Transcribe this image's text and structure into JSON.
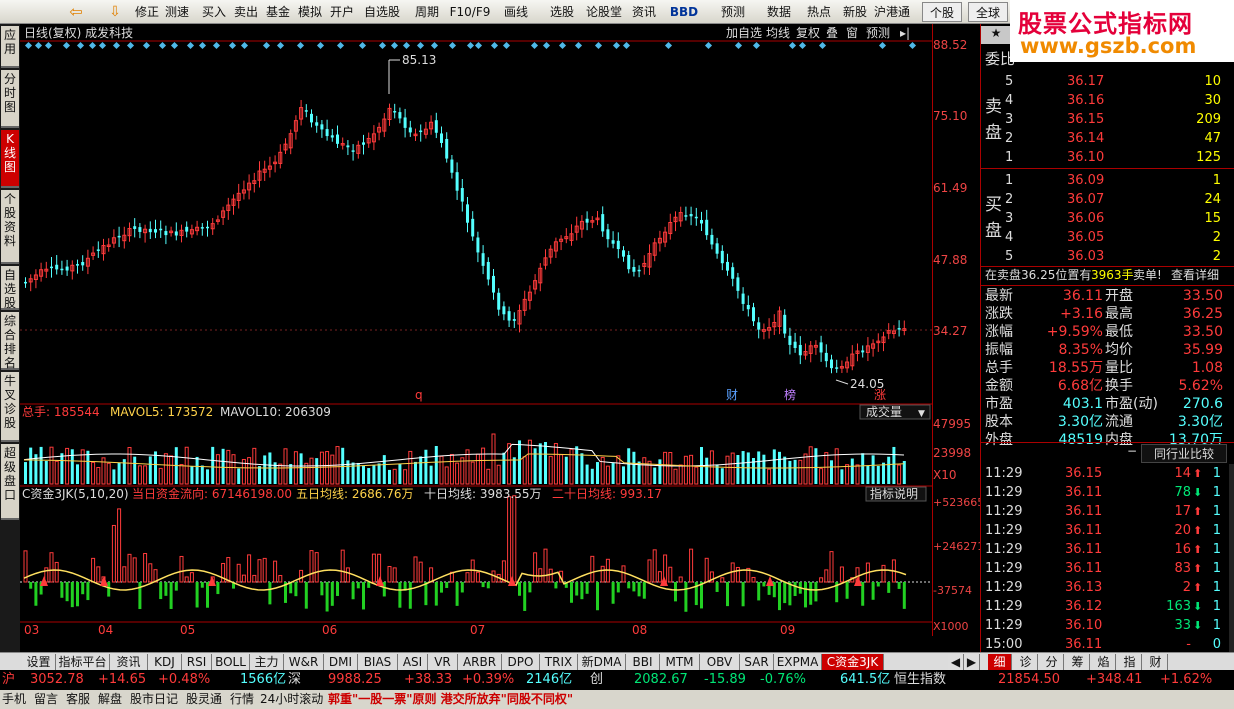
{
  "toolbar": {
    "items": [
      "修正",
      "测速",
      "买入",
      "卖出",
      "基金",
      "模拟",
      "开户",
      "自选股",
      "周期",
      "F10/F9",
      "画线",
      "选股",
      "论股堂",
      "资讯",
      "BBD",
      "预测",
      "数据",
      "热点",
      "新股",
      "沪港通",
      "个股",
      "全球"
    ]
  },
  "logo": {
    "line1": "股票公式指标网",
    "line2": "www.gszb.com"
  },
  "left_tabs": [
    "应用",
    "分时图",
    "K线图",
    "个股资料",
    "自选股",
    "综合排名",
    "牛叉诊股",
    "超级盘口"
  ],
  "chart": {
    "header_left": "日线(复权)   成发科技",
    "header_buttons": [
      "加自选",
      "均线",
      "复权",
      "叠",
      "窗",
      "预测"
    ],
    "price_axis": [
      "88.52",
      "75.10",
      "61.49",
      "47.88",
      "34.27"
    ],
    "high_label": "85.13",
    "low_label": "24.05",
    "event_labels": [
      "q",
      "财",
      "榜",
      "涨"
    ],
    "vol_header": {
      "total": "总手: 185544",
      "mavol5": "MAVOL5: 173572",
      "mavol10": "MAVOL10: 206309",
      "selector": "成交量"
    },
    "vol_axis": [
      "47995",
      "23998",
      "X10"
    ],
    "fund_header": {
      "name": "C资金3JK(5,10,20)",
      "t1": "当日资金流向: 67146198.00",
      "t2": "五日均线: 2686.76万",
      "t3": "十日均线: 3983.55万",
      "t4": "二十日均线: 993.17",
      "btn": "指标说明"
    },
    "fund_axis": [
      "+523665",
      "+246271",
      "-37574",
      "X1000"
    ],
    "months": [
      "03",
      "04",
      "05",
      "06",
      "07",
      "08",
      "09"
    ]
  },
  "orderbook": {
    "title": "委比",
    "sell_label": "卖盘",
    "buy_label": "买盘",
    "sell": [
      [
        "5",
        "36.17",
        "10"
      ],
      [
        "4",
        "36.16",
        "30"
      ],
      [
        "3",
        "36.15",
        "209"
      ],
      [
        "2",
        "36.14",
        "47"
      ],
      [
        "1",
        "36.10",
        "125"
      ]
    ],
    "buy": [
      [
        "1",
        "36.09",
        "1"
      ],
      [
        "2",
        "36.07",
        "24"
      ],
      [
        "3",
        "36.06",
        "15"
      ],
      [
        "4",
        "36.05",
        "2"
      ],
      [
        "5",
        "36.03",
        "2"
      ]
    ],
    "notice": "在卖盘36.25位置有",
    "notice_qty": "3963手",
    "notice_tail": "卖单!",
    "notice_link": "查看详细"
  },
  "stats": [
    [
      "最新",
      "36.11",
      "开盘",
      "33.50"
    ],
    [
      "涨跌",
      "+3.16",
      "最高",
      "36.25"
    ],
    [
      "涨幅",
      "+9.59%",
      "最低",
      "33.50"
    ],
    [
      "振幅",
      "8.35%",
      "均价",
      "35.99"
    ],
    [
      "总手",
      "18.55万",
      "量比",
      "1.08"
    ],
    [
      "金额",
      "6.68亿",
      "换手",
      "5.62%"
    ],
    [
      "市盈",
      "403.1",
      "市盈(动)",
      "270.6"
    ],
    [
      "股本",
      "3.30亿",
      "流通",
      "3.30亿"
    ],
    [
      "外盘",
      "48519",
      "内盘",
      "13.70万"
    ]
  ],
  "compare_btn": "同行业比较",
  "ticks": [
    [
      "11:29",
      "36.15",
      "14",
      "1"
    ],
    [
      "11:29",
      "36.11",
      "78",
      "1"
    ],
    [
      "11:29",
      "36.11",
      "17",
      "1"
    ],
    [
      "11:29",
      "36.11",
      "20",
      "1"
    ],
    [
      "11:29",
      "36.11",
      "16",
      "1"
    ],
    [
      "11:29",
      "36.11",
      "83",
      "1"
    ],
    [
      "11:29",
      "36.13",
      "2",
      "1"
    ],
    [
      "11:29",
      "36.12",
      "163",
      "1"
    ],
    [
      "11:29",
      "36.10",
      "33",
      "1"
    ],
    [
      "15:00",
      "36.11",
      "-",
      "0"
    ]
  ],
  "bottom_tabs": [
    "设置",
    "指标平台",
    "资讯",
    "KDJ",
    "RSI",
    "BOLL",
    "主力",
    "W&R",
    "DMI",
    "BIAS",
    "ASI",
    "VR",
    "ARBR",
    "DPO",
    "TRIX",
    "新DMA",
    "BBI",
    "MTM",
    "OBV",
    "SAR",
    "EXPMA",
    "C资金3JK"
  ],
  "right_tabs": [
    "细",
    "诊",
    "分",
    "筹",
    "焰",
    "指",
    "财"
  ],
  "status": {
    "sh": "沪",
    "sh_idx": "3052.78",
    "sh_chg": "+14.65",
    "sh_pct": "+0.48%",
    "sh_amt": "1566亿",
    "sz": "深",
    "sz_idx": "9988.25",
    "sz_chg": "+38.33",
    "sz_pct": "+0.39%",
    "sz_amt": "2146亿",
    "cy": "创",
    "cy_idx": "2082.67",
    "cy_chg": "-15.89",
    "cy_pct": "-0.76%",
    "cy_amt": "641.5亿",
    "hs": "恒生指数",
    "hs_idx": "21854.50",
    "hs_chg": "+348.41",
    "hs_pct": "+1.62%"
  },
  "ticker": {
    "items": [
      "手机",
      "留言",
      "客服",
      "解盘",
      "股市日记",
      "股灵通",
      "行情",
      "24小时滚动"
    ],
    "news": "郭重\"一股一票\"原则 港交所放弃\"同股不同权\""
  }
}
